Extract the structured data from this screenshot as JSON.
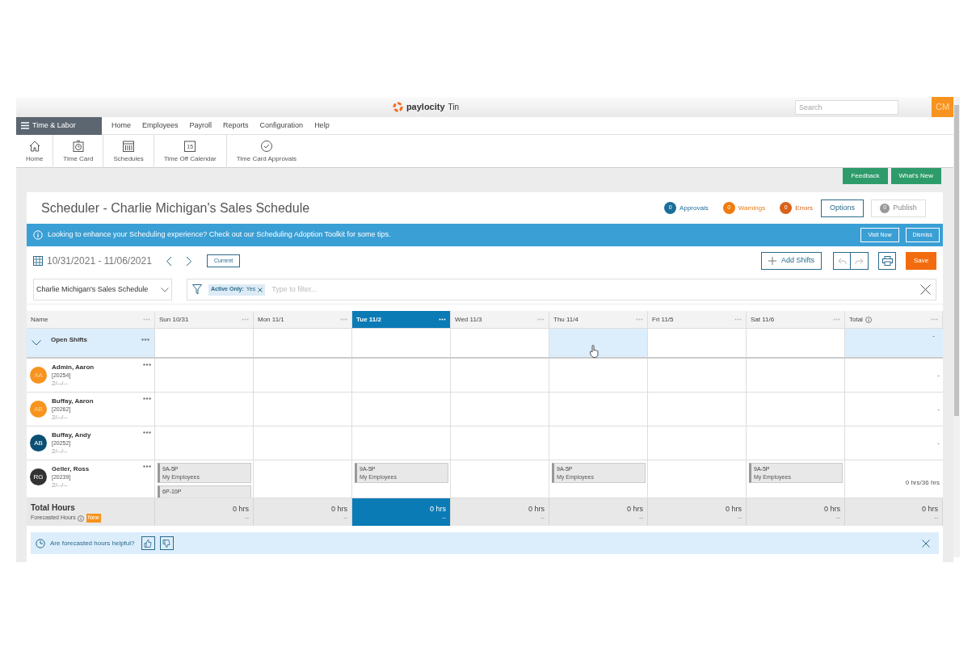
{
  "header": {
    "brand": "paylocity",
    "company": "Tin",
    "search": {
      "placeholder": "Search"
    },
    "avatar": "CM"
  },
  "nav": {
    "module": "Time & Labor",
    "menu": [
      "Home",
      "Employees",
      "Payroll",
      "Reports",
      "Configuration",
      "Help"
    ]
  },
  "toolbar": [
    {
      "kind": "home",
      "label": "Home"
    },
    {
      "kind": "timecard",
      "label": "Time Card"
    },
    {
      "kind": "schedules",
      "label": "Schedules"
    },
    {
      "kind": "calendar",
      "label": "Time Off Calendar",
      "day": "15"
    },
    {
      "kind": "approvals",
      "label": "Time Card Approvals"
    }
  ],
  "top_buttons": [
    "Feedback",
    "What's New"
  ],
  "scheduler": {
    "title": "Scheduler - Charlie Michigan's Sales Schedule",
    "statuses": [
      {
        "count": "0",
        "label": "Approvals",
        "color": "#1a6f9a"
      },
      {
        "count": "0",
        "label": "Warnings",
        "color": "#f07b0f"
      },
      {
        "count": "0",
        "label": "Errors",
        "color": "#d9621a"
      }
    ],
    "options": "Options",
    "publish": {
      "count": "0",
      "label": "Publish",
      "disabled": true
    }
  },
  "banner": {
    "text": "Looking to enhance your Scheduling experience? Check out our Scheduling Adoption Toolkit for some tips.",
    "buttons": [
      "Visit Now",
      "Dismiss"
    ]
  },
  "date_range": "10/31/2021 - 11/06/2021",
  "current": "Current",
  "add_shifts": "Add Shifts",
  "save": "Save",
  "schedule_select": "Charlie Michigan's Sales Schedule",
  "filter": {
    "chip_label": "Active Only:",
    "chip_value": "Yes",
    "placeholder": "Type to filter..."
  },
  "columns": [
    {
      "label": "Name",
      "selected": false
    },
    {
      "label": "Sun 10/31",
      "selected": false
    },
    {
      "label": "Mon 11/1",
      "selected": false
    },
    {
      "label": "Tue 11/2",
      "selected": true
    },
    {
      "label": "Wed 11/3",
      "selected": false
    },
    {
      "label": "Thu 11/4",
      "selected": false
    },
    {
      "label": "Fri 11/5",
      "selected": false
    },
    {
      "label": "Sat 11/6",
      "selected": false
    },
    {
      "label": "Total",
      "selected": false
    }
  ],
  "open_shifts": {
    "label": "Open Shifts",
    "expanded": false,
    "total": "-"
  },
  "employees": [
    {
      "name": "Admin, Aaron",
      "id": "[20254]",
      "date": "2/--/--",
      "initials": "AA",
      "color": "#f7931e",
      "total": "-",
      "cells": [
        {},
        {},
        {},
        {},
        {},
        {},
        {}
      ]
    },
    {
      "name": "Buffay, Aaron",
      "id": "[20262]",
      "date": "2/--/--",
      "initials": "AB",
      "color": "#f7931e",
      "total": "-",
      "cells": [
        {},
        {},
        {},
        {},
        {},
        {},
        {}
      ]
    },
    {
      "name": "Buffay, Andy",
      "id": "[20252]",
      "date": "2/--/--",
      "initials": "AB",
      "color": "#0b4f73",
      "total": "-",
      "cells": [
        {},
        {},
        {},
        {},
        {},
        {},
        {}
      ]
    },
    {
      "name": "Geller, Ross",
      "id": "[20239]",
      "date": "2/--/--",
      "initials": "RG",
      "color": "#333333",
      "total": "0 hrs/36 hrs",
      "cells": [
        {
          "shifts": [
            {
              "time": "9A-5P",
              "group": "My Employees"
            },
            {
              "time": "6P-10P"
            }
          ]
        },
        {},
        {
          "shifts": [
            {
              "time": "9A-5P",
              "group": "My Employees"
            }
          ]
        },
        {},
        {
          "shifts": [
            {
              "time": "9A-5P",
              "group": "My Employees"
            }
          ]
        },
        {},
        {
          "shifts": [
            {
              "time": "9A-5P",
              "group": "My Employees"
            }
          ]
        }
      ]
    }
  ],
  "totals": {
    "label": "Total Hours",
    "forecast_label": "Forecasted Hours",
    "badge": "New",
    "values": [
      {
        "hours": "0 hrs",
        "forecast": "--"
      },
      {
        "hours": "0 hrs",
        "forecast": "--"
      },
      {
        "hours": "0 hrs",
        "forecast": "--"
      },
      {
        "hours": "0 hrs",
        "forecast": "--"
      },
      {
        "hours": "0 hrs",
        "forecast": "--"
      },
      {
        "hours": "0 hrs",
        "forecast": "--"
      },
      {
        "hours": "0 hrs",
        "forecast": "--"
      },
      {
        "hours": "0 hrs",
        "forecast": "--"
      }
    ]
  },
  "feedback_bar": {
    "question": "Are forecasted hours helpful?"
  }
}
